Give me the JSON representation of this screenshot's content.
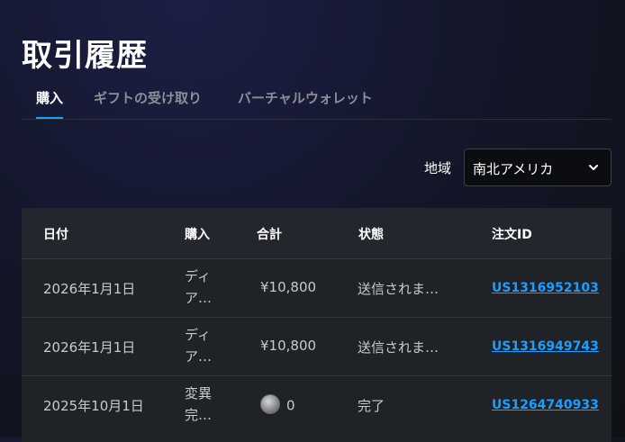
{
  "page": {
    "title": "取引履歴"
  },
  "tabs": [
    {
      "label": "購入",
      "active": true
    },
    {
      "label": "ギフトの受け取り",
      "active": false
    },
    {
      "label": "バーチャルウォレット",
      "active": false
    }
  ],
  "region": {
    "label": "地域",
    "selected": "南北アメリカ"
  },
  "table": {
    "headers": {
      "date": "日付",
      "purchase": "購入",
      "total": "合計",
      "status": "状態",
      "order_id": "注文ID"
    },
    "rows": [
      {
        "date": "2026年1月1日",
        "purchase": "ディア…",
        "total": "¥10,800",
        "status": "送信されま…",
        "order_id": "US1316952103"
      },
      {
        "date": "2026年1月1日",
        "purchase": "ディア…",
        "total": "¥10,800",
        "status": "送信されま…",
        "order_id": "US1316949743"
      },
      {
        "date": "2025年10月1日",
        "purchase": "変異完…",
        "total": "0",
        "total_icon": "coin-icon",
        "status": "完了",
        "order_id": "US1264740933"
      }
    ]
  },
  "colors": {
    "accent": "#1a9fff",
    "header_bg": "#23272d",
    "row_bg": "#1f2227"
  }
}
